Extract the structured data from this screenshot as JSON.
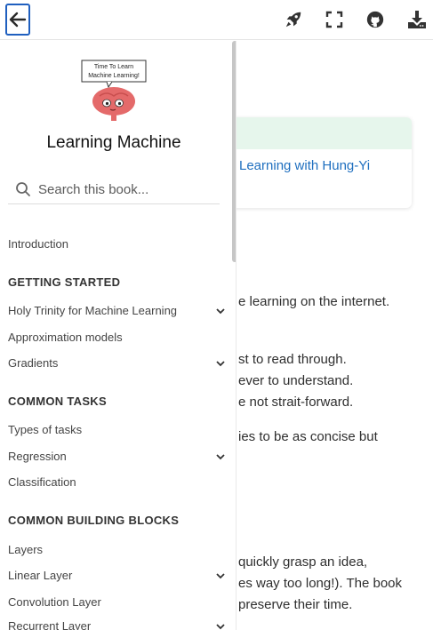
{
  "topbar": {
    "back_icon": "arrow-left-icon",
    "actions": [
      "rocket-icon",
      "fullscreen-icon",
      "github-icon",
      "download-icon"
    ]
  },
  "sidebar": {
    "logo_speech": [
      "Time To Learn",
      "Machine Learning!"
    ],
    "book_title": "Learning Machine",
    "search_placeholder": "Search this book...",
    "intro": "Introduction",
    "sections": [
      {
        "heading": "GETTING STARTED",
        "items": [
          {
            "label": "Holy Trinity for Machine Learning",
            "expandable": true
          },
          {
            "label": "Approximation models",
            "expandable": false
          },
          {
            "label": "Gradients",
            "expandable": true
          }
        ]
      },
      {
        "heading": "COMMON TASKS",
        "items": [
          {
            "label": "Types of tasks",
            "expandable": false
          },
          {
            "label": "Regression",
            "expandable": true
          },
          {
            "label": "Classification",
            "expandable": false
          }
        ]
      },
      {
        "heading": "COMMON BUILDING BLOCKS",
        "items": [
          {
            "label": "Layers",
            "expandable": false
          },
          {
            "label": "Linear Layer",
            "expandable": true
          },
          {
            "label": "Convolution Layer",
            "expandable": false
          },
          {
            "label": "Recurrent Layer",
            "expandable": true
          }
        ]
      }
    ]
  },
  "main": {
    "card_link": "Learning with Hung-Yi",
    "paragraph_fragments": [
      "e learning on the internet.",
      "st to read through.",
      "ever to understand.",
      "e not strait-forward.",
      "ies to be as concise but",
      "quickly grasp an idea,",
      "es way too long!). The book",
      "preserve their time."
    ]
  }
}
